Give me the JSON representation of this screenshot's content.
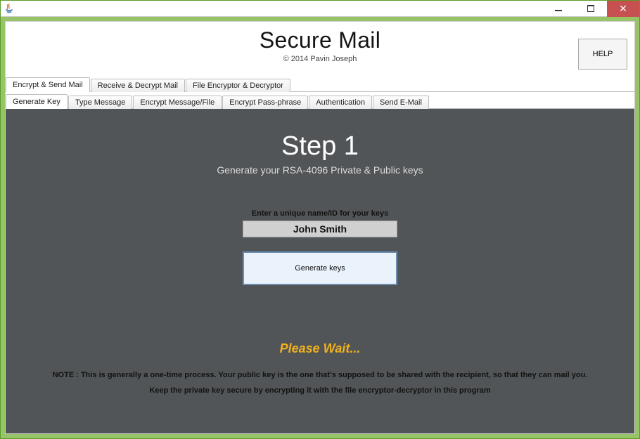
{
  "window": {
    "java_icon": "java-icon"
  },
  "header": {
    "title": "Secure Mail",
    "copyright": "© 2014 Pavin Joseph",
    "help_label": "HELP"
  },
  "tabs_outer": [
    {
      "label": "Encrypt & Send Mail",
      "active": true
    },
    {
      "label": "Receive & Decrypt Mail",
      "active": false
    },
    {
      "label": "File Encryptor & Decryptor",
      "active": false
    }
  ],
  "tabs_inner": [
    {
      "label": "Generate Key",
      "active": true
    },
    {
      "label": "Type Message",
      "active": false
    },
    {
      "label": "Encrypt Message/File",
      "active": false
    },
    {
      "label": "Encrypt Pass-phrase",
      "active": false
    },
    {
      "label": "Authentication",
      "active": false
    },
    {
      "label": "Send E-Mail",
      "active": false
    }
  ],
  "step": {
    "title": "Step 1",
    "subtitle": "Generate your RSA-4096 Private & Public keys",
    "input_label": "Enter a unique name/ID for your keys",
    "input_value": "John Smith",
    "generate_label": "Generate keys",
    "wait_text": "Please Wait...",
    "note_line1": "NOTE : This is generally a one-time process. Your public key is the one that's supposed to be shared with the recipient, so that they can mail you.",
    "note_line2": "Keep the private key secure by encrypting it with the file encryptor-decryptor in this program"
  }
}
